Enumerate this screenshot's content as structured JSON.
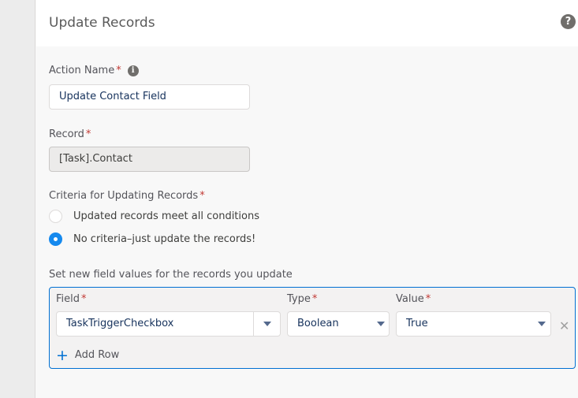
{
  "header": {
    "title": "Update Records",
    "help_icon": "?"
  },
  "action_name": {
    "label": "Action Name",
    "required": "*",
    "info_icon": "i",
    "value": "Update Contact Field"
  },
  "record": {
    "label": "Record",
    "required": "*",
    "value": "[Task].Contact"
  },
  "criteria": {
    "label": "Criteria for Updating Records",
    "required": "*",
    "options": [
      {
        "label": "Updated records meet all conditions",
        "checked": false
      },
      {
        "label": "No criteria–just update the records!",
        "checked": true
      }
    ]
  },
  "field_values": {
    "label": "Set new field values for the records you update",
    "columns": {
      "field": "Field",
      "type": "Type",
      "value": "Value",
      "required": "*"
    },
    "rows": [
      {
        "field": "TaskTriggerCheckbox",
        "type": "Boolean",
        "value": "True",
        "remove_icon": "✕"
      }
    ],
    "add_row": {
      "icon": "+",
      "label": "Add Row"
    }
  }
}
